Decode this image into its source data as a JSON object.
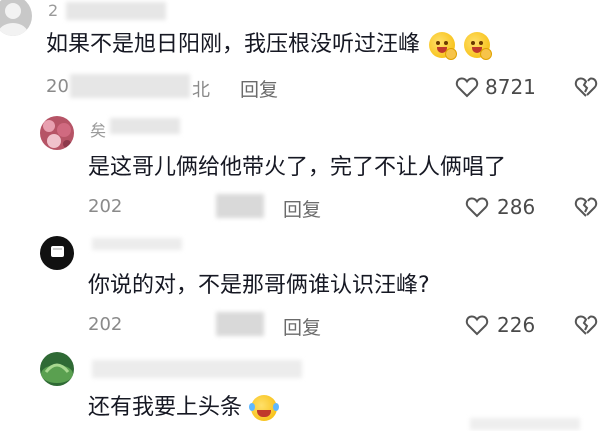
{
  "comments": [
    {
      "username": "2",
      "text": "如果不是旭日阳刚，我压根没听过汪峰",
      "emoji": [
        "face-covering-mouth-emoji",
        "face-covering-mouth-emoji"
      ],
      "date": "20",
      "location": "北",
      "reply_label": "回复",
      "like_count": "8721"
    },
    {
      "username": "矣",
      "text": "是这哥儿俩给他带火了，完了不让人俩唱了",
      "date": "202",
      "reply_label": "回复",
      "like_count": "286"
    },
    {
      "username": "",
      "text": "你说的对，不是那哥俩谁认识汪峰?",
      "date": "202",
      "reply_label": "回复",
      "like_count": "226"
    },
    {
      "username": "",
      "text": "还有我要上头条",
      "emoji": [
        "rolling-laughing-emoji"
      ]
    }
  ],
  "icons": {
    "like": "heart-outline-icon",
    "dislike": "broken-heart-outline-icon"
  },
  "colors": {
    "text": "#161823",
    "muted": "#8a8a8a"
  }
}
